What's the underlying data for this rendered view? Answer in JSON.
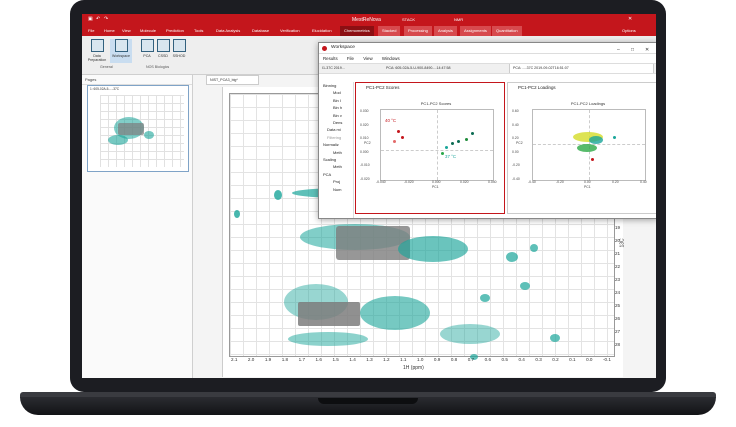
{
  "app": {
    "titlebar_right": "MestReNova",
    "context_group_stack": "STACK",
    "context_group_nmr": "NMR",
    "options": "Options"
  },
  "ribbon_tabs": [
    "File",
    "Home",
    "View",
    "Molecule",
    "Prediction",
    "Tools",
    "Data Analysis",
    "Database",
    "Verification",
    "Elucidation",
    "Chemometrics",
    "Stacked",
    "Processing",
    "Analysis",
    "Assignments",
    "Quantitation"
  ],
  "ribbon": {
    "buttons": [
      "Data Preparation",
      "Workspace",
      "PCA",
      "CSSD",
      "SSHOD"
    ],
    "groups": [
      "General",
      "NOS Biologics"
    ]
  },
  "pages": {
    "header": "Pages",
    "thumb_title": "1: 605-02A-5-...-37C"
  },
  "document_tab": "NIST_PCA3_big*",
  "spectrum": {
    "x_ticks": [
      "2.1",
      "2.0",
      "1.9",
      "1.8",
      "1.7",
      "1.6",
      "1.5",
      "1.4",
      "1.3",
      "1.2",
      "1.1",
      "1.0",
      "0.9",
      "0.8",
      "0.7",
      "0.6",
      "0.5",
      "0.4",
      "0.3",
      "0.2",
      "0.1",
      "0.0",
      "-0.1"
    ],
    "y_ticks": [
      "19",
      "20",
      "21",
      "22",
      "23",
      "24",
      "25",
      "26",
      "27",
      "28"
    ],
    "x_label": "1H (ppm)",
    "y_label": "13C (ppm)"
  },
  "workspace": {
    "title": "Workspace",
    "menu": [
      "Results",
      "File",
      "View",
      "Windows"
    ],
    "tabs": [
      "I1-37C 2019...",
      "PCA: 605-02A-5-U-900-8490-...14:47:58",
      "PCA: ...-37C 2019-09-02T16:51:07"
    ],
    "tree": [
      "Binning",
      "Mod",
      "Bin I",
      "Bin h",
      "Bin v",
      "Dens",
      "Data mi",
      "Filtering",
      "Normaliz",
      "Meth",
      "Scaling",
      "Meth",
      "PCA",
      "Proj",
      "Num"
    ],
    "scores": {
      "header": "PC1-PC2 Scores",
      "title": "PC1-PC2 Scores",
      "xlabel": "PC1",
      "ylabel": "PC2",
      "label_hot": "40 °C",
      "label_cold": "37 °C",
      "xticks": [
        "-0.040",
        "-0.020",
        "0.000",
        "0.020",
        "0.040"
      ],
      "yticks": [
        "0.030",
        "0.020",
        "0.010",
        "0.000",
        "-0.010",
        "-0.020"
      ]
    },
    "loadings": {
      "header": "PC1-PC2 Loadings",
      "title": "PC1-PC2 Loadings",
      "xlabel": "PC1",
      "ylabel": "PC2",
      "xticks": [
        "-0.40",
        "-0.20",
        "0.00",
        "0.20",
        "0.40"
      ],
      "yticks": [
        "0.60",
        "0.40",
        "0.20",
        "0.00",
        "-0.20",
        "-0.40"
      ]
    }
  },
  "colors": {
    "brand_red": "#c4161c",
    "teal": "#1aa59a",
    "gray_region": "#7d7d7d"
  }
}
